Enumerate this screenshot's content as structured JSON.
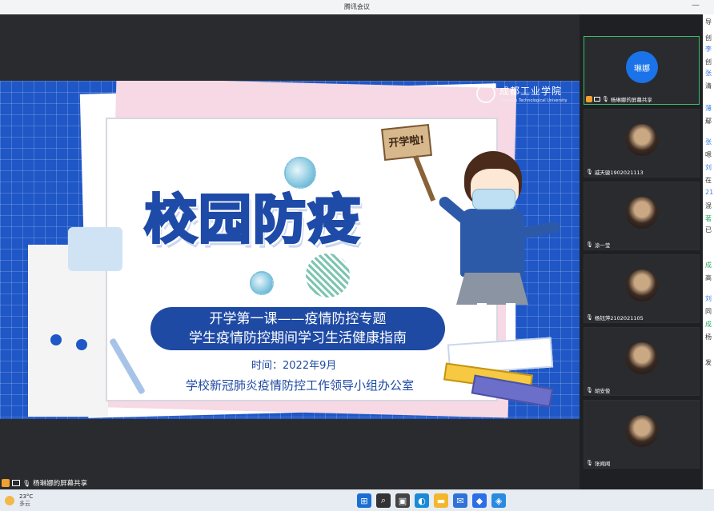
{
  "window": {
    "title": "腾讯会议",
    "min_glyph": "—"
  },
  "slide": {
    "logo_cn": "成都工业学院",
    "logo_en": "Chengdu Technological University",
    "sign_text": "开学啦!",
    "main_title": "校园防疫",
    "pill_line1": "开学第一课——疫情防控专题",
    "pill_line2": "学生疫情防控期间学习生活健康指南",
    "date": "时间：2022年9月",
    "office": "学校新冠肺炎疫情防控工作领导小组办公室"
  },
  "share_label": "杨琳娜的屏幕共享",
  "participants": [
    {
      "name": "杨琳娜的屏幕共享",
      "avatar_text": "琳娜",
      "active": true
    },
    {
      "name": "戚天骏1902021113"
    },
    {
      "name": "涂一莹"
    },
    {
      "name": "杨钰萍2102021105"
    },
    {
      "name": "胡安俊"
    },
    {
      "name": "张闻闻"
    }
  ],
  "chat_glimpses": [
    {
      "t": "导",
      "c": ""
    },
    {
      "t": "创",
      "c": ""
    },
    {
      "t": "李",
      "c": "blue"
    },
    {
      "t": "创",
      "c": ""
    },
    {
      "t": "张",
      "c": "blue"
    },
    {
      "t": "清",
      "c": ""
    },
    {
      "t": "薄",
      "c": "blue"
    },
    {
      "t": "鄢",
      "c": ""
    },
    {
      "t": "张",
      "c": "blue"
    },
    {
      "t": "嗯",
      "c": ""
    },
    {
      "t": "刘",
      "c": "blue"
    },
    {
      "t": "在",
      "c": ""
    },
    {
      "t": "21",
      "c": "blue"
    },
    {
      "t": "混",
      "c": ""
    },
    {
      "t": "著",
      "c": "green"
    },
    {
      "t": "已",
      "c": ""
    },
    {
      "t": "成",
      "c": "green"
    },
    {
      "t": "高",
      "c": ""
    },
    {
      "t": "刘",
      "c": "blue"
    },
    {
      "t": "同",
      "c": ""
    },
    {
      "t": "成",
      "c": "green"
    },
    {
      "t": "杨",
      "c": ""
    },
    {
      "t": "发",
      "c": ""
    }
  ],
  "taskbar": {
    "temp": "23°C",
    "weather": "多云",
    "icons": [
      {
        "name": "start-icon",
        "glyph": "⊞",
        "color": "#1a6fd4"
      },
      {
        "name": "search-icon",
        "glyph": "⌕",
        "color": "#333333"
      },
      {
        "name": "task-view-icon",
        "glyph": "▣",
        "color": "#444444"
      },
      {
        "name": "edge-icon",
        "glyph": "◐",
        "color": "#1b8ad6"
      },
      {
        "name": "explorer-icon",
        "glyph": "▬",
        "color": "#f3b72c"
      },
      {
        "name": "mail-icon",
        "glyph": "✉",
        "color": "#2f73d6"
      },
      {
        "name": "tencent-meeting-icon",
        "glyph": "◆",
        "color": "#2a6ee8"
      },
      {
        "name": "security-icon",
        "glyph": "◈",
        "color": "#2a8ae0"
      }
    ]
  }
}
